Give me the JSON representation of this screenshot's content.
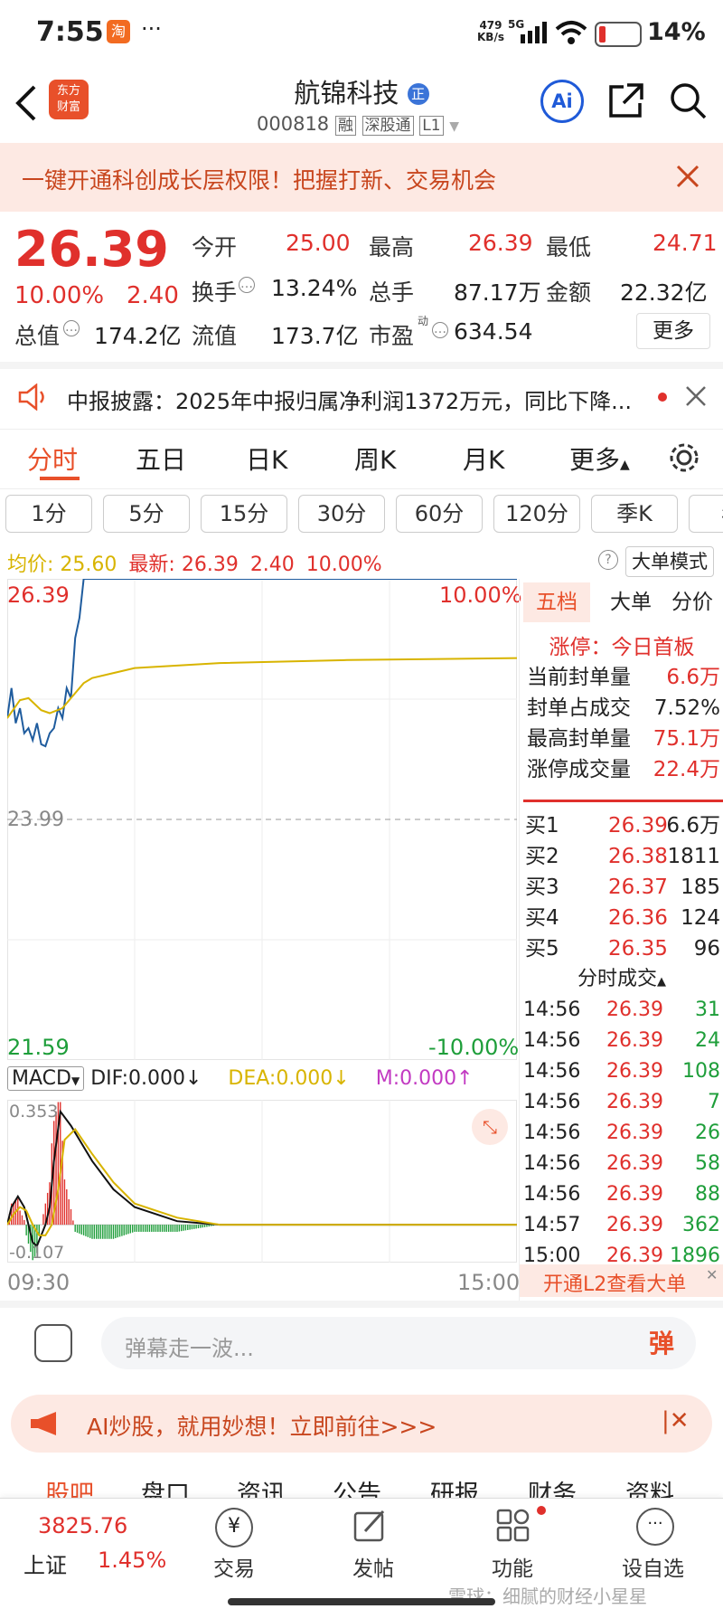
{
  "status_bar": {
    "time": "7:55",
    "app_badge": "淘",
    "dots": "···",
    "net_speed_top": "479",
    "net_speed_bottom": "KB/s",
    "network": "5G",
    "battery": "14%"
  },
  "header": {
    "logo_line1": "东方",
    "logo_line2": "财富",
    "stock_name": "航锦科技",
    "name_badge": "正",
    "stock_code": "000818",
    "tags": [
      "融",
      "深股通",
      "L1"
    ],
    "ai_label": "Ai"
  },
  "banner": {
    "text": "一键开通科创成长层权限！把握打新、交易机会"
  },
  "quote": {
    "price": "26.39",
    "change_pct": "10.00%",
    "change": "2.40",
    "open_label": "今开",
    "open": "25.00",
    "high_label": "最高",
    "high": "26.39",
    "low_label": "最低",
    "low": "24.71",
    "turnover_label": "换手",
    "turnover": "13.24%",
    "volume_label": "总手",
    "volume": "87.17万",
    "amount_label": "金额",
    "amount": "22.32亿",
    "mktcap_label": "总值",
    "mktcap": "174.2亿",
    "float_label": "流值",
    "float": "173.7亿",
    "pe_label": "市盈",
    "pe_sup": "动",
    "pe": "634.54",
    "more": "更多"
  },
  "notice": {
    "text": "中报披露：2025年中报归属净利润1372万元，同比下降..."
  },
  "chart_tabs": {
    "items": [
      "分时",
      "五日",
      "日K",
      "周K",
      "月K",
      "更多"
    ]
  },
  "period_tabs": {
    "items": [
      "1分",
      "5分",
      "15分",
      "30分",
      "60分",
      "120分",
      "季K",
      "年"
    ]
  },
  "info_bar": {
    "avg_label": "均价:",
    "avg": "25.60",
    "last_label": "最新:",
    "last": "26.39",
    "chg": "2.40",
    "pct": "10.00%",
    "big_order": "大单模式"
  },
  "price_axis": {
    "top": "26.39",
    "mid": "23.99",
    "bottom": "21.59",
    "top_pct": "10.00%",
    "bottom_pct": "-10.00%",
    "time_start": "09:30",
    "time_end": "15:00"
  },
  "macd": {
    "label": "MACD",
    "dif": "DIF:0.000",
    "dea": "DEA:0.000",
    "m": "M:0.000",
    "top": "0.353",
    "bottom": "-0.107"
  },
  "chart_data": [
    {
      "type": "line",
      "xlabel": "",
      "ylabel": "",
      "x_range": [
        "09:30",
        "15:00"
      ],
      "ylim": [
        21.59,
        26.39
      ],
      "reference": 23.99,
      "series": [
        {
          "color": "#1f5c9e",
          "x": [
            0,
            2,
            4,
            6,
            8,
            10,
            12,
            14,
            16,
            18,
            20,
            22,
            24,
            26,
            28,
            30,
            32,
            34,
            36,
            240
          ],
          "y": [
            25.0,
            25.3,
            24.95,
            25.1,
            24.85,
            24.9,
            24.78,
            24.95,
            24.74,
            24.72,
            24.85,
            24.9,
            25.1,
            25.0,
            25.3,
            25.2,
            25.8,
            26.0,
            26.39,
            26.39
          ]
        },
        {
          "color": "#d8b400",
          "x": [
            0,
            6,
            10,
            16,
            20,
            26,
            30,
            36,
            40,
            60,
            100,
            160,
            240
          ],
          "y": [
            25.0,
            25.18,
            25.2,
            25.08,
            25.05,
            25.1,
            25.2,
            25.35,
            25.4,
            25.5,
            25.55,
            25.58,
            25.6
          ]
        }
      ]
    },
    {
      "type": "line",
      "ylim": [
        -0.107,
        0.353
      ],
      "series": [
        {
          "color": "#111111",
          "x": [
            0,
            2,
            5,
            8,
            10,
            12,
            14,
            16,
            18,
            20,
            22,
            25,
            30,
            40,
            50,
            60,
            80,
            100,
            240
          ],
          "y": [
            0.0,
            0.05,
            0.08,
            0.05,
            0.0,
            -0.05,
            -0.06,
            -0.03,
            0.0,
            0.05,
            0.18,
            0.32,
            0.28,
            0.18,
            0.1,
            0.05,
            0.01,
            0.0,
            0.0
          ]
        },
        {
          "color": "#d8b400",
          "x": [
            0,
            3,
            6,
            9,
            12,
            15,
            18,
            21,
            24,
            27,
            32,
            40,
            50,
            60,
            80,
            100,
            240
          ],
          "y": [
            0.0,
            0.03,
            0.05,
            0.04,
            0.0,
            -0.03,
            -0.03,
            0.0,
            0.1,
            0.24,
            0.27,
            0.2,
            0.12,
            0.06,
            0.02,
            0.0,
            0.0
          ]
        }
      ]
    }
  ],
  "side_panel": {
    "tabs": [
      "五档",
      "大单",
      "分价"
    ],
    "limit_label": "涨停：今日首板",
    "stats": [
      {
        "label": "当前封单量",
        "value": "6.6万"
      },
      {
        "label": "封单占成交",
        "value": "7.52%"
      },
      {
        "label": "最高封单量",
        "value": "75.1万"
      },
      {
        "label": "涨停成交量",
        "value": "22.4万"
      }
    ],
    "bids": [
      {
        "label": "买1",
        "price": "26.39",
        "vol": "6.6万"
      },
      {
        "label": "买2",
        "price": "26.38",
        "vol": "1811"
      },
      {
        "label": "买3",
        "price": "26.37",
        "vol": "185"
      },
      {
        "label": "买4",
        "price": "26.36",
        "vol": "124"
      },
      {
        "label": "买5",
        "price": "26.35",
        "vol": "96"
      }
    ],
    "ticks_title": "分时成交",
    "ticks": [
      {
        "time": "14:56",
        "price": "26.39",
        "vol": "31"
      },
      {
        "time": "14:56",
        "price": "26.39",
        "vol": "24"
      },
      {
        "time": "14:56",
        "price": "26.39",
        "vol": "108"
      },
      {
        "time": "14:56",
        "price": "26.39",
        "vol": "7"
      },
      {
        "time": "14:56",
        "price": "26.39",
        "vol": "26"
      },
      {
        "time": "14:56",
        "price": "26.39",
        "vol": "58"
      },
      {
        "time": "14:56",
        "price": "26.39",
        "vol": "88"
      },
      {
        "time": "14:57",
        "price": "26.39",
        "vol": "362"
      },
      {
        "time": "15:00",
        "price": "26.39",
        "vol": "1896"
      }
    ],
    "l2_label": "开通L2查看大单"
  },
  "comment": {
    "placeholder": "弹幕走一波...",
    "danmu": "弹"
  },
  "ai_banner": {
    "text": "AI炒股，就用妙想！立即前往>>>"
  },
  "sub_tabs": {
    "items": [
      "股吧",
      "盘口",
      "资讯",
      "公告",
      "研报",
      "财务",
      "资料"
    ]
  },
  "bottom_nav": {
    "index_value": "3825.76",
    "index_name": "上证",
    "index_pct": "1.45%",
    "items": [
      "交易",
      "发帖",
      "功能",
      "设自选"
    ]
  },
  "watermark": "雪球：细腻的财经小星星",
  "colors": {
    "up": "#e0302c",
    "down": "#1e9e3a",
    "accent": "#e8502a",
    "blue": "#1f5ad8"
  }
}
